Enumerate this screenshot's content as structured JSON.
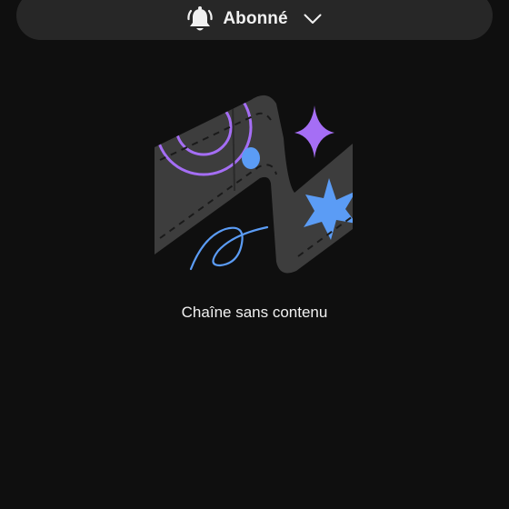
{
  "subscription": {
    "label": "Abonné",
    "icon": "bell-icon",
    "dropdown_icon": "chevron-down-icon"
  },
  "empty_state": {
    "message": "Chaîne sans contenu",
    "illustration": "empty-channel-illustration"
  },
  "colors": {
    "background": "#0f0f0f",
    "pill": "#272727",
    "text": "#f1f1f1",
    "purple_accent": "#a56ef5",
    "blue_accent": "#5b9cf5",
    "ribbon": "#3d3d3d"
  }
}
